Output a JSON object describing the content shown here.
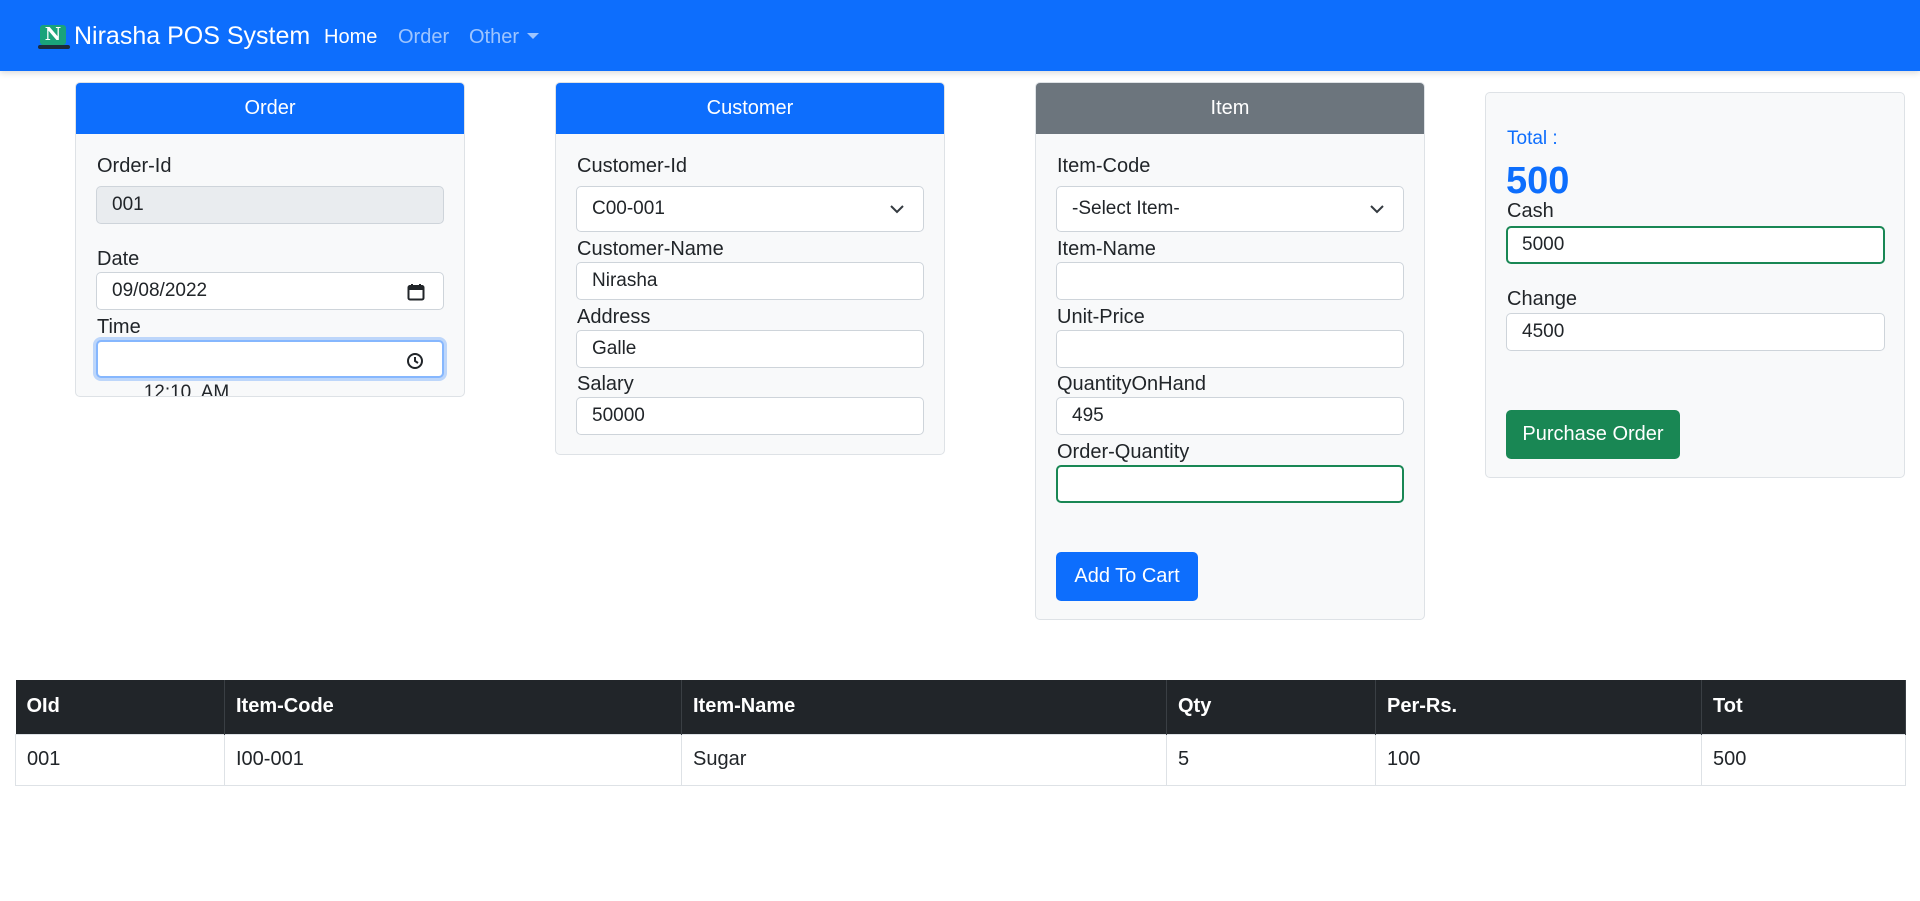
{
  "navbar": {
    "brand_letter": "N",
    "brand": "Nirasha POS System",
    "links": [
      {
        "label": "Home"
      },
      {
        "label": "Order"
      },
      {
        "label": "Other"
      }
    ]
  },
  "order_card": {
    "title": "Order",
    "order_id_label": "Order-Id",
    "order_id_value": "001",
    "date_label": "Date",
    "date_value": "09/08/2022",
    "time_label": "Time",
    "time_value": "12:10  AM"
  },
  "customer_card": {
    "title": "Customer",
    "customer_id_label": "Customer-Id",
    "customer_id_value": "C00-001",
    "customer_name_label": "Customer-Name",
    "customer_name_value": "Nirasha",
    "address_label": "Address",
    "address_value": "Galle",
    "salary_label": "Salary",
    "salary_value": "50000"
  },
  "item_card": {
    "title": "Item",
    "item_code_label": "Item-Code",
    "item_code_value": "-Select Item-",
    "item_name_label": "Item-Name",
    "item_name_value": "",
    "unit_price_label": "Unit-Price",
    "unit_price_value": "",
    "qoh_label": "QuantityOnHand",
    "qoh_value": "495",
    "order_qty_label": "Order-Quantity",
    "order_qty_value": "",
    "add_button": "Add To Cart"
  },
  "summary": {
    "total_label": "Total :",
    "total_value": "500",
    "cash_label": "Cash",
    "cash_value": "5000",
    "change_label": "Change",
    "change_value": "4500",
    "purchase_button": "Purchase Order"
  },
  "cart_table": {
    "headers": [
      "OId",
      "Item-Code",
      "Item-Name",
      "Qty",
      "Per-Rs.",
      "Tot"
    ],
    "rows": [
      [
        "001",
        "I00-001",
        "Sugar",
        "5",
        "100",
        "500"
      ]
    ]
  },
  "colors": {
    "primary": "#0d6efd",
    "secondary": "#6c757d",
    "success": "#198754",
    "table_header": "#212529"
  }
}
